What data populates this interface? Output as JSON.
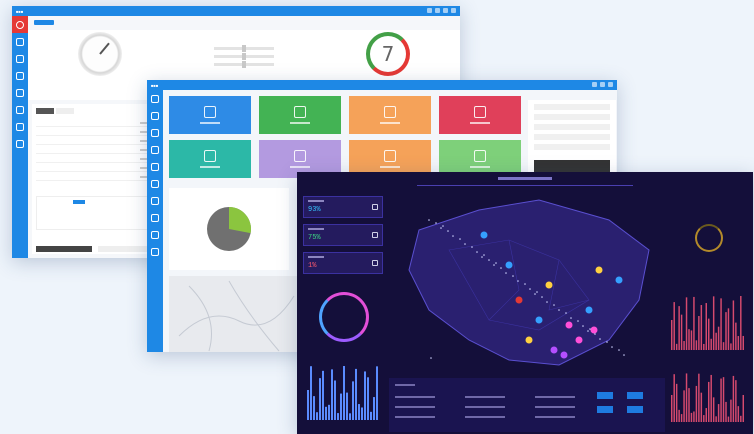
{
  "colors": {
    "page_bg": "#eef4fb",
    "admin_blue": "#1e88e5",
    "active_red": "#e53935",
    "dash_bg": "#140f3a",
    "dash_accent": "#35c3ff",
    "dash_magenta": "#e24fd8"
  },
  "admin_window": {
    "sidebar_icons": [
      "home-icon",
      "chart-icon",
      "bike-icon",
      "warning-icon",
      "document-icon",
      "user-icon",
      "edit-icon",
      "file-icon"
    ],
    "gauge_value": "7"
  },
  "tiles_window": {
    "tiles": [
      {
        "name": "recycle-icon",
        "color": "#2e8be6"
      },
      {
        "name": "home-icon",
        "color": "#43b354"
      },
      {
        "name": "tool-icon",
        "color": "#f5a259"
      },
      {
        "name": "warning-icon",
        "color": "#e0405a"
      },
      {
        "name": "building-icon",
        "color": "#2cb8a7"
      },
      {
        "name": "document-icon",
        "color": "#b39ae0"
      },
      {
        "name": "basket-icon",
        "color": "#f5a259"
      },
      {
        "name": "monitor-icon",
        "color": "#7ed07a"
      }
    ],
    "donut": {
      "gray_share": 0.72,
      "green_share": 0.28
    }
  },
  "dashboard_window": {
    "stat_values": [
      "93%",
      "75%",
      "1%"
    ],
    "map_markers": [
      {
        "color": "#e53935"
      },
      {
        "color": "#ff4fd8"
      },
      {
        "color": "#b44fff"
      },
      {
        "color": "#ffd040"
      },
      {
        "color": "#35a0ff"
      }
    ]
  }
}
